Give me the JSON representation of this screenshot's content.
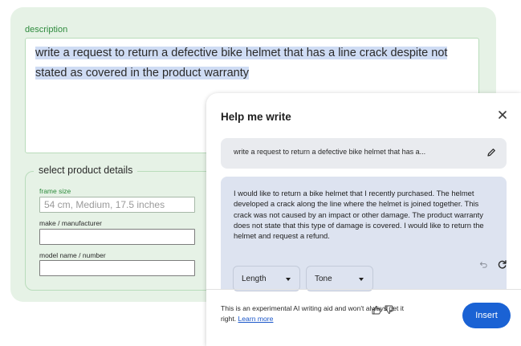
{
  "form": {
    "description_label": "description",
    "description_text": "write a request to return a defective bike helmet that has a line crack despite not stated as covered in the product warranty",
    "details_legend": "select product details",
    "fields": [
      {
        "label": "frame size",
        "value": "",
        "placeholder": "54 cm, Medium, 17.5 inches"
      },
      {
        "label": "make / manufacturer",
        "value": "",
        "placeholder": ""
      },
      {
        "label": "model name / number",
        "value": "",
        "placeholder": ""
      }
    ]
  },
  "help_me_write": {
    "title": "Help me write",
    "prompt": "write a request to return a defective bike helmet that has a...",
    "response": "I would like to return a bike helmet that I recently purchased. The helmet developed a crack along the line where the helmet is joined together. This crack was not caused by an impact or other damage. The product warranty does not state that this type of damage is covered. I would like to return the helmet and request a refund.",
    "length_label": "Length",
    "tone_label": "Tone",
    "disclaimer": "This is an experimental AI writing aid and won't always get it right.",
    "learn_more": "Learn more",
    "insert_label": "Insert"
  },
  "colors": {
    "form_bg": "#e6f2e6",
    "accent_green": "#2e8b3d",
    "highlight": "#cfdcf4",
    "response_bg": "#dde3f0",
    "insert_button": "#1a62d4",
    "link": "#1a56c9"
  },
  "icons": [
    "close-icon",
    "pencil-icon",
    "undo-icon",
    "refresh-icon",
    "chevron-down-icon",
    "thumbs-up-icon",
    "thumbs-down-icon"
  ]
}
